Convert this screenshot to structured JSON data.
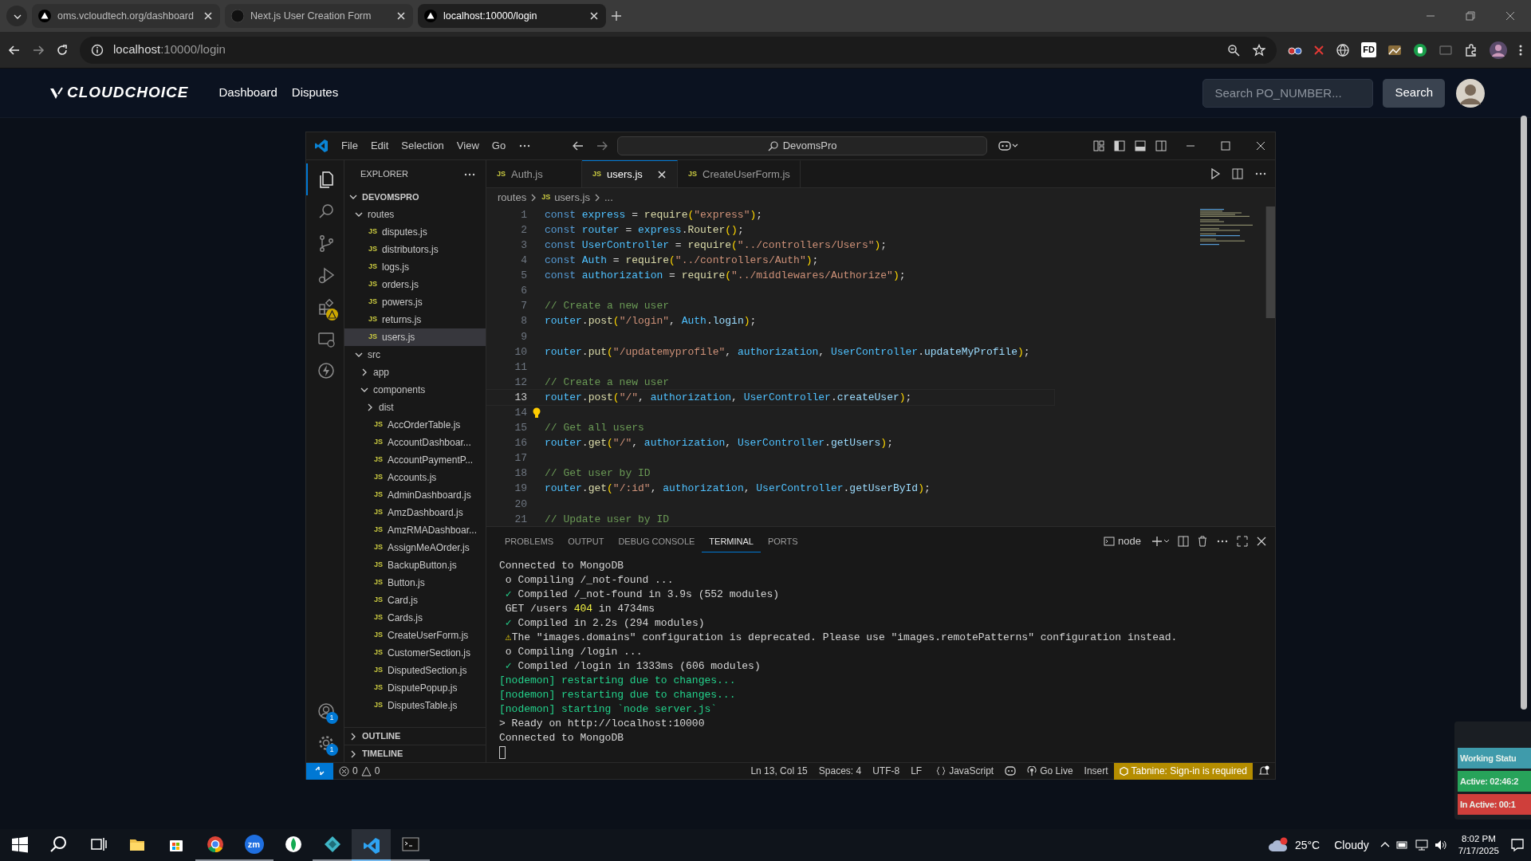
{
  "browser": {
    "tabs": [
      {
        "title": "oms.vcloudtech.org/dashboard",
        "selected": false,
        "kind": "triangle"
      },
      {
        "title": "Next.js User Creation Form",
        "selected": false,
        "kind": "circle"
      },
      {
        "title": "localhost:10000/login",
        "selected": true,
        "kind": "triangle"
      }
    ],
    "address": {
      "host": "localhost",
      "path": ":10000/login"
    },
    "extension_label": "FD"
  },
  "site": {
    "brand": "CLOUDCHOICE",
    "links": [
      "Dashboard",
      "Disputes"
    ],
    "search": {
      "placeholder": "Search PO_NUMBER..."
    },
    "search_button": "Search"
  },
  "vscode": {
    "menu": [
      "File",
      "Edit",
      "Selection",
      "View",
      "Go"
    ],
    "command_center": "DevomsPro",
    "activity": [
      {
        "kind": "explorer",
        "selected": true,
        "alert": false
      },
      {
        "kind": "search",
        "selected": false,
        "alert": false
      },
      {
        "kind": "source-control",
        "selected": false,
        "alert": false
      },
      {
        "kind": "run-debug",
        "selected": false,
        "alert": false
      },
      {
        "kind": "extensions",
        "selected": false,
        "alert": true
      },
      {
        "kind": "remote",
        "selected": false,
        "alert": false
      },
      {
        "kind": "lightning",
        "selected": false,
        "alert": false
      }
    ],
    "activity_bottom": [
      {
        "kind": "accounts",
        "badge": "1"
      },
      {
        "kind": "settings",
        "badge": "1"
      }
    ],
    "explorer": {
      "title": "EXPLORER",
      "tree": [
        {
          "label": "DEVOMSPRO",
          "kind": "root",
          "expanded": true,
          "selected": false,
          "children": [
            {
              "label": "routes",
              "kind": "folder",
              "expanded": true,
              "selected": false,
              "children": [
                {
                  "label": "disputes.js",
                  "kind": "file",
                  "badge": "JS",
                  "selected": false
                },
                {
                  "label": "distributors.js",
                  "kind": "file",
                  "badge": "JS",
                  "selected": false
                },
                {
                  "label": "logs.js",
                  "kind": "file",
                  "badge": "JS",
                  "selected": false
                },
                {
                  "label": "orders.js",
                  "kind": "file",
                  "badge": "JS",
                  "selected": false
                },
                {
                  "label": "powers.js",
                  "kind": "file",
                  "badge": "JS",
                  "selected": false
                },
                {
                  "label": "returns.js",
                  "kind": "file",
                  "badge": "JS",
                  "selected": false
                },
                {
                  "label": "users.js",
                  "kind": "file",
                  "badge": "JS",
                  "selected": true
                }
              ]
            },
            {
              "label": "src",
              "kind": "folder",
              "expanded": true,
              "selected": false,
              "children": [
                {
                  "label": "app",
                  "kind": "folder",
                  "expanded": false,
                  "selected": false
                },
                {
                  "label": "components",
                  "kind": "folder",
                  "expanded": true,
                  "selected": false,
                  "children": [
                    {
                      "label": "dist",
                      "kind": "folder",
                      "expanded": false,
                      "selected": false
                    },
                    {
                      "label": "AccOrderTable.js",
                      "kind": "file",
                      "badge": "JS",
                      "selected": false
                    },
                    {
                      "label": "AccountDashboar...",
                      "kind": "file",
                      "badge": "JS",
                      "selected": false
                    },
                    {
                      "label": "AccountPaymentP...",
                      "kind": "file",
                      "badge": "JS",
                      "selected": false
                    },
                    {
                      "label": "Accounts.js",
                      "kind": "file",
                      "badge": "JS",
                      "selected": false
                    },
                    {
                      "label": "AdminDashboard.js",
                      "kind": "file",
                      "badge": "JS",
                      "selected": false
                    },
                    {
                      "label": "AmzDashboard.js",
                      "kind": "file",
                      "badge": "JS",
                      "selected": false
                    },
                    {
                      "label": "AmzRMADashboar...",
                      "kind": "file",
                      "badge": "JS",
                      "selected": false
                    },
                    {
                      "label": "AssignMeAOrder.js",
                      "kind": "file",
                      "badge": "JS",
                      "selected": false
                    },
                    {
                      "label": "BackupButton.js",
                      "kind": "file",
                      "badge": "JS",
                      "selected": false
                    },
                    {
                      "label": "Button.js",
                      "kind": "file",
                      "badge": "JS",
                      "selected": false
                    },
                    {
                      "label": "Card.js",
                      "kind": "file",
                      "badge": "JS",
                      "selected": false
                    },
                    {
                      "label": "Cards.js",
                      "kind": "file",
                      "badge": "JS",
                      "selected": false
                    },
                    {
                      "label": "CreateUserForm.js",
                      "kind": "file",
                      "badge": "JS",
                      "selected": false
                    },
                    {
                      "label": "CustomerSection.js",
                      "kind": "file",
                      "badge": "JS",
                      "selected": false
                    },
                    {
                      "label": "DisputedSection.js",
                      "kind": "file",
                      "badge": "JS",
                      "selected": false
                    },
                    {
                      "label": "DisputePopup.js",
                      "kind": "file",
                      "badge": "JS",
                      "selected": false
                    },
                    {
                      "label": "DisputesTable.js",
                      "kind": "file",
                      "badge": "JS",
                      "selected": false
                    }
                  ]
                }
              ]
            }
          ]
        }
      ],
      "sections": [
        {
          "label": "OUTLINE",
          "expanded": false
        },
        {
          "label": "TIMELINE",
          "expanded": false
        }
      ]
    },
    "editor_tabs": [
      {
        "badge": "JS",
        "label": "Auth.js",
        "selected": false
      },
      {
        "badge": "JS",
        "label": "users.js",
        "selected": true
      },
      {
        "badge": "JS",
        "label": "CreateUserForm.js",
        "selected": false
      }
    ],
    "breadcrumbs": [
      {
        "label": "routes"
      },
      {
        "badge": "JS",
        "label": "users.js"
      },
      {
        "label": "..."
      }
    ],
    "code": [
      {
        "number": "1",
        "active": false,
        "lightbulb": false,
        "tokens": [
          {
            "kind": "kw",
            "text": "const "
          },
          {
            "kind": "cv",
            "text": "express"
          },
          {
            "kind": "pl",
            "text": " = "
          },
          {
            "kind": "fn",
            "text": "require"
          },
          {
            "kind": "br",
            "text": "("
          },
          {
            "kind": "str",
            "text": "\"express\""
          },
          {
            "kind": "br",
            "text": ")"
          },
          {
            "kind": "pl",
            "text": ";"
          }
        ]
      },
      {
        "number": "2",
        "active": false,
        "lightbulb": false,
        "tokens": [
          {
            "kind": "kw",
            "text": "const "
          },
          {
            "kind": "cv",
            "text": "router"
          },
          {
            "kind": "pl",
            "text": " = "
          },
          {
            "kind": "cv",
            "text": "express"
          },
          {
            "kind": "pl",
            "text": "."
          },
          {
            "kind": "fn",
            "text": "Router"
          },
          {
            "kind": "br",
            "text": "()"
          },
          {
            "kind": "pl",
            "text": ";"
          }
        ]
      },
      {
        "number": "3",
        "active": false,
        "lightbulb": false,
        "tokens": [
          {
            "kind": "kw",
            "text": "const "
          },
          {
            "kind": "cv",
            "text": "UserController"
          },
          {
            "kind": "pl",
            "text": " = "
          },
          {
            "kind": "fn",
            "text": "require"
          },
          {
            "kind": "br",
            "text": "("
          },
          {
            "kind": "str",
            "text": "\"../controllers/Users\""
          },
          {
            "kind": "br",
            "text": ")"
          },
          {
            "kind": "pl",
            "text": ";"
          }
        ]
      },
      {
        "number": "4",
        "active": false,
        "lightbulb": false,
        "tokens": [
          {
            "kind": "kw",
            "text": "const "
          },
          {
            "kind": "cv",
            "text": "Auth"
          },
          {
            "kind": "pl",
            "text": " = "
          },
          {
            "kind": "fn",
            "text": "require"
          },
          {
            "kind": "br",
            "text": "("
          },
          {
            "kind": "str",
            "text": "\"../controllers/Auth\""
          },
          {
            "kind": "br",
            "text": ")"
          },
          {
            "kind": "pl",
            "text": ";"
          }
        ]
      },
      {
        "number": "5",
        "active": false,
        "lightbulb": false,
        "tokens": [
          {
            "kind": "kw",
            "text": "const "
          },
          {
            "kind": "cv",
            "text": "authorization"
          },
          {
            "kind": "pl",
            "text": " = "
          },
          {
            "kind": "fn",
            "text": "require"
          },
          {
            "kind": "br",
            "text": "("
          },
          {
            "kind": "str",
            "text": "\"../middlewares/Authorize\""
          },
          {
            "kind": "br",
            "text": ")"
          },
          {
            "kind": "pl",
            "text": ";"
          }
        ]
      },
      {
        "number": "6",
        "active": false,
        "lightbulb": false
      },
      {
        "number": "7",
        "active": false,
        "lightbulb": false,
        "tokens": [
          {
            "kind": "cm",
            "text": "// Create a new user"
          }
        ]
      },
      {
        "number": "8",
        "active": false,
        "lightbulb": false,
        "tokens": [
          {
            "kind": "cv",
            "text": "router"
          },
          {
            "kind": "pl",
            "text": "."
          },
          {
            "kind": "fn",
            "text": "post"
          },
          {
            "kind": "br",
            "text": "("
          },
          {
            "kind": "str",
            "text": "\"/login\""
          },
          {
            "kind": "pl",
            "text": ", "
          },
          {
            "kind": "cv",
            "text": "Auth"
          },
          {
            "kind": "pl",
            "text": "."
          },
          {
            "kind": "pr",
            "text": "login"
          },
          {
            "kind": "br",
            "text": ")"
          },
          {
            "kind": "pl",
            "text": ";"
          }
        ]
      },
      {
        "number": "9",
        "active": false,
        "lightbulb": false
      },
      {
        "number": "10",
        "active": false,
        "lightbulb": false,
        "tokens": [
          {
            "kind": "cv",
            "text": "router"
          },
          {
            "kind": "pl",
            "text": "."
          },
          {
            "kind": "fn",
            "text": "put"
          },
          {
            "kind": "br",
            "text": "("
          },
          {
            "kind": "str",
            "text": "\"/updatemyprofile\""
          },
          {
            "kind": "pl",
            "text": ", "
          },
          {
            "kind": "cv",
            "text": "authorization"
          },
          {
            "kind": "pl",
            "text": ", "
          },
          {
            "kind": "cv",
            "text": "UserController"
          },
          {
            "kind": "pl",
            "text": "."
          },
          {
            "kind": "pr",
            "text": "updateMyProfile"
          },
          {
            "kind": "br",
            "text": ")"
          },
          {
            "kind": "pl",
            "text": ";"
          }
        ]
      },
      {
        "number": "11",
        "active": false,
        "lightbulb": false
      },
      {
        "number": "12",
        "active": false,
        "lightbulb": false,
        "tokens": [
          {
            "kind": "cm",
            "text": "// Create a new user"
          }
        ]
      },
      {
        "number": "13",
        "active": true,
        "lightbulb": false,
        "tokens": [
          {
            "kind": "cv",
            "text": "router"
          },
          {
            "kind": "pl",
            "text": "."
          },
          {
            "kind": "fn",
            "text": "post"
          },
          {
            "kind": "br",
            "text": "("
          },
          {
            "kind": "str",
            "text": "\"/\""
          },
          {
            "kind": "pl",
            "text": ", "
          },
          {
            "kind": "cv",
            "text": "authorization"
          },
          {
            "kind": "pl",
            "text": ", "
          },
          {
            "kind": "cv",
            "text": "UserController"
          },
          {
            "kind": "pl",
            "text": "."
          },
          {
            "kind": "pr",
            "text": "createUser"
          },
          {
            "kind": "br",
            "text": ")"
          },
          {
            "kind": "pl",
            "text": ";"
          }
        ]
      },
      {
        "number": "14",
        "active": false,
        "lightbulb": true
      },
      {
        "number": "15",
        "active": false,
        "lightbulb": false,
        "tokens": [
          {
            "kind": "cm",
            "text": "// Get all users"
          }
        ]
      },
      {
        "number": "16",
        "active": false,
        "lightbulb": false,
        "tokens": [
          {
            "kind": "cv",
            "text": "router"
          },
          {
            "kind": "pl",
            "text": "."
          },
          {
            "kind": "fn",
            "text": "get"
          },
          {
            "kind": "br",
            "text": "("
          },
          {
            "kind": "str",
            "text": "\"/\""
          },
          {
            "kind": "pl",
            "text": ", "
          },
          {
            "kind": "cv",
            "text": "authorization"
          },
          {
            "kind": "pl",
            "text": ", "
          },
          {
            "kind": "cv",
            "text": "UserController"
          },
          {
            "kind": "pl",
            "text": "."
          },
          {
            "kind": "pr",
            "text": "getUsers"
          },
          {
            "kind": "br",
            "text": ")"
          },
          {
            "kind": "pl",
            "text": ";"
          }
        ]
      },
      {
        "number": "17",
        "active": false,
        "lightbulb": false
      },
      {
        "number": "18",
        "active": false,
        "lightbulb": false,
        "tokens": [
          {
            "kind": "cm",
            "text": "// Get user by ID"
          }
        ]
      },
      {
        "number": "19",
        "active": false,
        "lightbulb": false,
        "tokens": [
          {
            "kind": "cv",
            "text": "router"
          },
          {
            "kind": "pl",
            "text": "."
          },
          {
            "kind": "fn",
            "text": "get"
          },
          {
            "kind": "br",
            "text": "("
          },
          {
            "kind": "str",
            "text": "\"/:id\""
          },
          {
            "kind": "pl",
            "text": ", "
          },
          {
            "kind": "cv",
            "text": "authorization"
          },
          {
            "kind": "pl",
            "text": ", "
          },
          {
            "kind": "cv",
            "text": "UserController"
          },
          {
            "kind": "pl",
            "text": "."
          },
          {
            "kind": "pr",
            "text": "getUserById"
          },
          {
            "kind": "br",
            "text": ")"
          },
          {
            "kind": "pl",
            "text": ";"
          }
        ]
      },
      {
        "number": "20",
        "active": false,
        "lightbulb": false
      },
      {
        "number": "21",
        "active": false,
        "lightbulb": false,
        "tokens": [
          {
            "kind": "cm",
            "text": "// Update user by ID"
          }
        ]
      }
    ],
    "panel": {
      "tabs": [
        {
          "label": "PROBLEMS",
          "selected": false
        },
        {
          "label": "OUTPUT",
          "selected": false
        },
        {
          "label": "DEBUG CONSOLE",
          "selected": false
        },
        {
          "label": "TERMINAL",
          "selected": true
        },
        {
          "label": "PORTS",
          "selected": false
        }
      ],
      "terminal_name": "node",
      "lines": [
        [
          {
            "kind": "pl",
            "text": "Connected to MongoDB"
          }
        ],
        [
          {
            "kind": "pl",
            "text": " o Compiling /_not-found ..."
          }
        ],
        [
          {
            "kind": "ok",
            "text": " ✓"
          },
          {
            "kind": "pl",
            "text": " Compiled /_not-found in 3.9s (552 modules)"
          }
        ],
        [
          {
            "kind": "pl",
            "text": " GET /users "
          },
          {
            "kind": "num",
            "text": "404"
          },
          {
            "kind": "pl",
            "text": " in 4734ms"
          }
        ],
        [
          {
            "kind": "ok",
            "text": " ✓"
          },
          {
            "kind": "pl",
            "text": " Compiled in 2.2s (294 modules)"
          }
        ],
        [
          {
            "kind": "warn",
            "text": " ⚠"
          },
          {
            "kind": "pl",
            "text": "The \"images.domains\" configuration is deprecated. Please use \"images.remotePatterns\" configuration instead."
          }
        ],
        [
          {
            "kind": "pl",
            "text": " o Compiling /login ..."
          }
        ],
        [
          {
            "kind": "ok",
            "text": " ✓"
          },
          {
            "kind": "pl",
            "text": " Compiled /login in 1333ms (606 modules)"
          }
        ],
        [
          {
            "kind": "nm",
            "text": "[nodemon] restarting due to changes..."
          }
        ],
        [
          {
            "kind": "nm",
            "text": "[nodemon] restarting due to changes..."
          }
        ],
        [
          {
            "kind": "nm",
            "text": "[nodemon] starting `node server.js`"
          }
        ],
        [
          {
            "kind": "pl",
            "text": "> Ready on http://localhost:10000"
          }
        ],
        [
          {
            "kind": "pl",
            "text": "Connected to MongoDB"
          }
        ]
      ]
    },
    "status": {
      "errors": "0",
      "warnings": "0",
      "items": [
        "Ln 13, Col 15",
        "Spaces: 4",
        "UTF-8",
        "LF"
      ],
      "language": "JavaScript",
      "go_live": "Go Live",
      "mode": "Insert",
      "tabnine": "Tabnine: Sign-in is required"
    }
  },
  "work_status": [
    {
      "label": "Working Statu",
      "color": "#3f9bab"
    },
    {
      "label": "Active: 02:46:2",
      "color": "#27a35a"
    },
    {
      "label": "In Active: 00:1",
      "color": "#cf3f3b"
    }
  ],
  "taskbar": {
    "apps": [
      {
        "kind": "explorer",
        "running": false,
        "active": false
      },
      {
        "kind": "store",
        "running": false,
        "active": false
      },
      {
        "kind": "chrome",
        "running": true,
        "active": false
      },
      {
        "kind": "zoom",
        "label": "zm",
        "running": true,
        "active": false
      },
      {
        "kind": "mongo",
        "running": false,
        "active": false
      },
      {
        "kind": "diamond",
        "running": true,
        "active": false
      },
      {
        "kind": "vscode",
        "running": true,
        "active": true
      },
      {
        "kind": "terminal",
        "running": true,
        "active": false
      }
    ],
    "weather": {
      "temp": "25°C",
      "condition": "Cloudy"
    },
    "time": "8:02 PM",
    "date": "7/17/2025"
  }
}
